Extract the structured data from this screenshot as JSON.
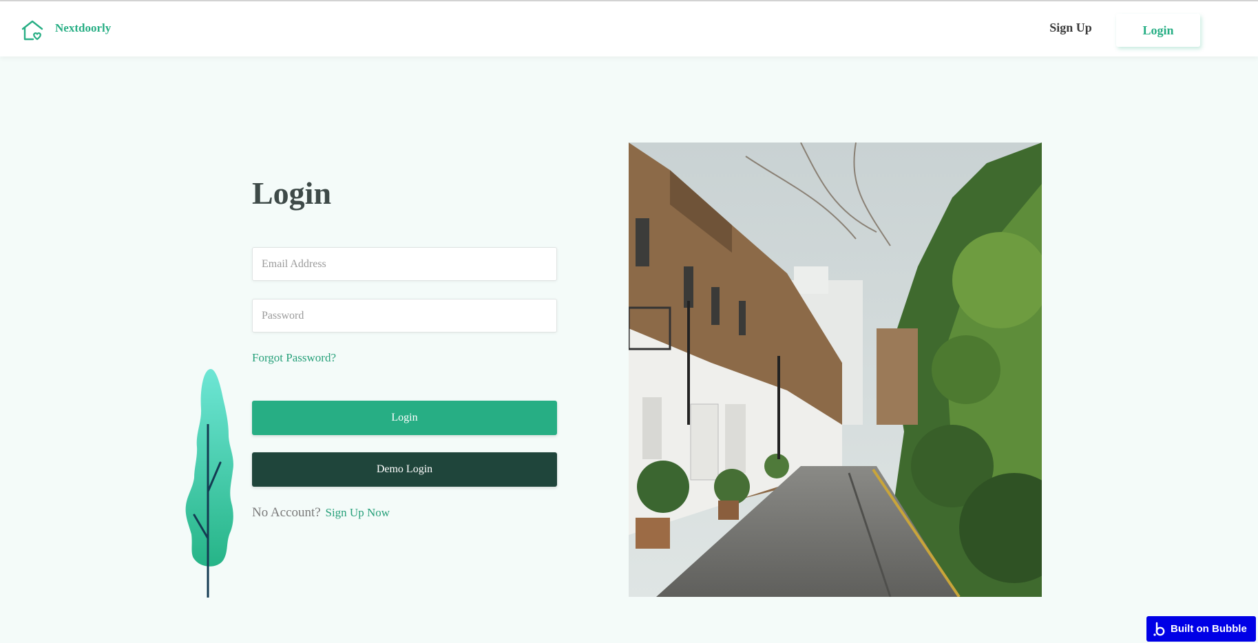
{
  "app": {
    "brand": "Nextdoorly"
  },
  "nav": {
    "signup_label": "Sign Up",
    "login_label": "Login"
  },
  "login_form": {
    "title": "Login",
    "email_placeholder": "Email Address",
    "password_placeholder": "Password",
    "forgot_label": "Forgot Password?",
    "login_button": "Login",
    "demo_button": "Demo Login",
    "no_account_text": "No Account?",
    "signup_link": "Sign Up Now"
  },
  "badge": {
    "label": "Built on Bubble"
  },
  "icons": {
    "logo": "house-heart-icon",
    "tree": "tree-illustration",
    "bubble": "bubble-logo-icon"
  },
  "colors": {
    "accent": "#27ae84",
    "dark_button": "#1f453b",
    "background": "#f4fbf9",
    "badge": "#0000e6"
  }
}
